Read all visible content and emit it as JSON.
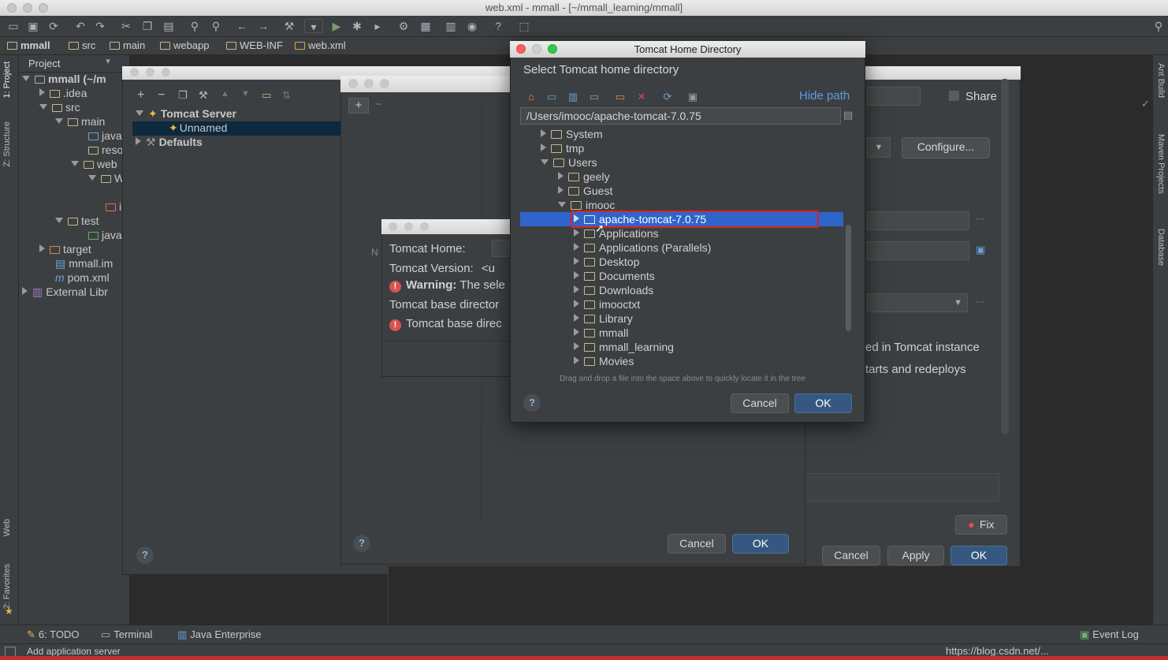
{
  "window": {
    "title": "web.xml - mmall - [~/mmall_learning/mmall]"
  },
  "breadcrumb": {
    "items": [
      "mmall",
      "src",
      "main",
      "webapp",
      "WEB-INF",
      "web.xml"
    ]
  },
  "project_panel": {
    "header": "Project",
    "tree": [
      {
        "label": "mmall (~/m",
        "depth": 0,
        "expanded": true
      },
      {
        "label": ".idea",
        "depth": 1,
        "expanded": false
      },
      {
        "label": "src",
        "depth": 1,
        "expanded": true
      },
      {
        "label": "main",
        "depth": 2,
        "expanded": true
      },
      {
        "label": "java",
        "depth": 3
      },
      {
        "label": "reso",
        "depth": 3
      },
      {
        "label": "web",
        "depth": 3,
        "expanded": true
      },
      {
        "label": "W",
        "depth": 4,
        "expanded": true
      },
      {
        "label": "i",
        "depth": 5
      },
      {
        "label": "test",
        "depth": 2,
        "expanded": true
      },
      {
        "label": "java",
        "depth": 3
      },
      {
        "label": "target",
        "depth": 1,
        "expanded": false
      },
      {
        "label": "mmall.im",
        "depth": 1
      },
      {
        "label": "pom.xml",
        "depth": 1
      },
      {
        "label": "External Libr",
        "depth": 0,
        "expanded": false
      }
    ]
  },
  "left_strip": {
    "project": "1: Project",
    "structure": "Z: Structure",
    "web": "Web",
    "favorites": "2: Favorites"
  },
  "right_strip": {
    "ant": "Ant Build",
    "maven": "Maven Projects",
    "database": "Database"
  },
  "run_config": {
    "tree_server": "Tomcat Server",
    "tree_unnamed": "Unnamed",
    "tree_defaults": "Defaults",
    "share_label": "Share",
    "configure_label": "Configure...",
    "deployed_text": "ed in Tomcat instance",
    "redeploy_text": "tarts and redeploys",
    "fix_label": "Fix",
    "cancel_label": "Cancel",
    "apply_label": "Apply",
    "ok_label": "OK",
    "help": "?"
  },
  "mid_dialog": {
    "cancel_label": "Cancel",
    "ok_label": "OK",
    "help": "?",
    "add": "+",
    "remove": "−"
  },
  "tomcat_small": {
    "home_label": "Tomcat Home:",
    "version_label": "Tomcat Version:",
    "version_value": "<u",
    "warning_bold": "Warning:",
    "warning_text": "The sele",
    "base_dir_label": "Tomcat base director",
    "base_dir_error": "Tomcat base direc",
    "name_hint": "N"
  },
  "chooser": {
    "title": "Tomcat Home Directory",
    "subtitle": "Select Tomcat home directory",
    "hide_path": "Hide path",
    "path_value": "/Users/imooc/apache-tomcat-7.0.75",
    "hint": "Drag and drop a file into the space above to quickly locate it in the tree",
    "cancel_label": "Cancel",
    "ok_label": "OK",
    "help": "?",
    "tree": [
      {
        "label": "System",
        "depth": 0,
        "expanded": false
      },
      {
        "label": "tmp",
        "depth": 0,
        "expanded": false
      },
      {
        "label": "Users",
        "depth": 0,
        "expanded": true
      },
      {
        "label": "geely",
        "depth": 1,
        "expanded": false
      },
      {
        "label": "Guest",
        "depth": 1,
        "expanded": false
      },
      {
        "label": "imooc",
        "depth": 1,
        "expanded": true
      },
      {
        "label": "apache-tomcat-7.0.75",
        "depth": 2,
        "expanded": false,
        "selected": true
      },
      {
        "label": "Applications",
        "depth": 2,
        "expanded": false
      },
      {
        "label": "Applications (Parallels)",
        "depth": 2,
        "expanded": false
      },
      {
        "label": "Desktop",
        "depth": 2,
        "expanded": false
      },
      {
        "label": "Documents",
        "depth": 2,
        "expanded": false
      },
      {
        "label": "Downloads",
        "depth": 2,
        "expanded": false
      },
      {
        "label": "imooctxt",
        "depth": 2,
        "expanded": false
      },
      {
        "label": "Library",
        "depth": 2,
        "expanded": false
      },
      {
        "label": "mmall",
        "depth": 2,
        "expanded": false
      },
      {
        "label": "mmall_learning",
        "depth": 2,
        "expanded": false
      },
      {
        "label": "Movies",
        "depth": 2,
        "expanded": false
      }
    ]
  },
  "bottom_tabs": {
    "todo": "6: TODO",
    "terminal": "Terminal",
    "java_enterprise": "Java Enterprise",
    "event_log": "Event Log"
  },
  "status": {
    "message": "Add application server"
  },
  "watermark": "https://blog.csdn.net/...",
  "colors": {
    "selection": "#2f65ca",
    "highlight_box": "#e02020",
    "primary_button": "#365880",
    "link": "#5d9bea"
  }
}
